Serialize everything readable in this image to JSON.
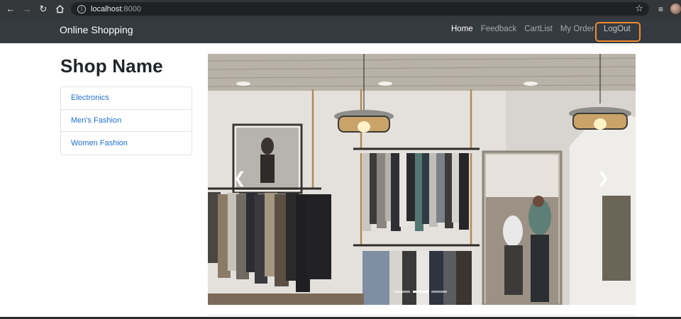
{
  "browser": {
    "url_host": "localhost",
    "url_port": ":8000"
  },
  "navbar": {
    "brand": "Online Shopping",
    "links": [
      {
        "label": "Home",
        "active": true
      },
      {
        "label": "Feedback",
        "active": false
      },
      {
        "label": "CartList",
        "active": false
      },
      {
        "label": "My Order",
        "active": false
      }
    ],
    "logout_label": "LogOut",
    "highlight_color": "#f08b2c"
  },
  "sidebar": {
    "title": "Shop Name",
    "categories": [
      {
        "label": "Electronics"
      },
      {
        "label": "Men's Fashion"
      },
      {
        "label": "Women Fashion"
      }
    ]
  },
  "carousel": {
    "prev_icon": "chevron-left-icon",
    "next_icon": "chevron-right-icon",
    "slide_count": 3,
    "active_slide": 2
  },
  "colors": {
    "navbar_bg": "#343a40",
    "link_color": "#1f6fd1"
  }
}
